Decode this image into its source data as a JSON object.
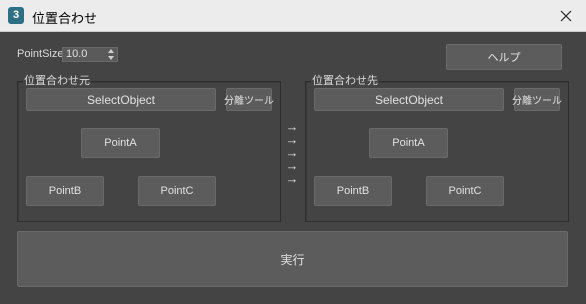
{
  "window": {
    "title": "位置合わせ",
    "icon_label": "3"
  },
  "controls": {
    "point_size_label": "PointSize",
    "point_size_value": "10.0",
    "help_button": "ヘルプ"
  },
  "source": {
    "group_label": "位置合わせ元",
    "select_button": "SelectObject",
    "detach_button": "分離ツール",
    "point_a": "PointA",
    "point_b": "PointB",
    "point_c": "PointC"
  },
  "target": {
    "group_label": "位置合わせ先",
    "select_button": "SelectObject",
    "detach_button": "分離ツール",
    "point_a": "PointA",
    "point_b": "PointB",
    "point_c": "PointC"
  },
  "arrows": [
    "→",
    "→",
    "→",
    "→",
    "→"
  ],
  "execute_button": "実行",
  "icons": {
    "close": "close-icon",
    "app": "app-icon",
    "spinner": "spinner-arrows-icon"
  },
  "colors": {
    "background": "#444444",
    "button": "#5c5c5c",
    "titlebar": "#ececec",
    "app_icon": "#2f6f86"
  }
}
